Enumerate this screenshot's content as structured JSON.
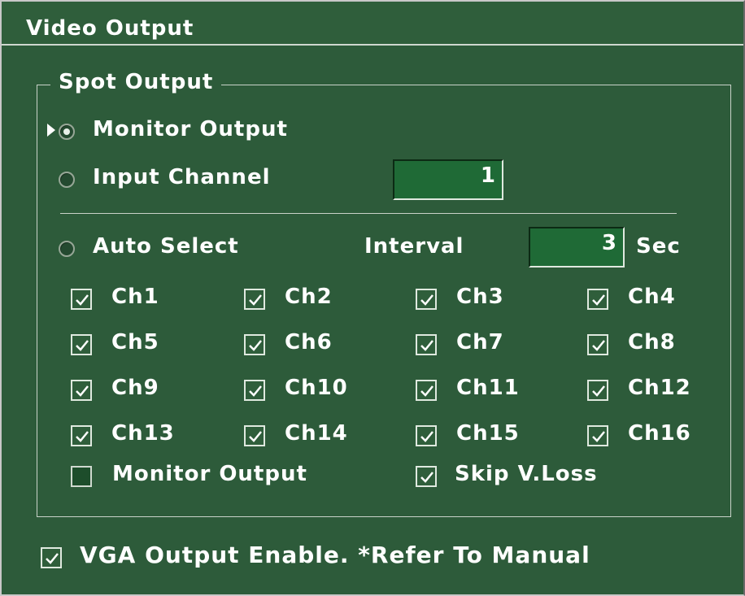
{
  "window": {
    "title": "Video Output"
  },
  "spot_output": {
    "legend": "Spot Output",
    "monitor_output_label": "Monitor Output",
    "input_channel_label": "Input Channel",
    "input_channel_value": "1",
    "auto_select_label": "Auto Select",
    "interval_label": "Interval",
    "interval_value": "3",
    "interval_unit": "Sec",
    "channels": [
      {
        "label": "Ch1",
        "checked": true
      },
      {
        "label": "Ch2",
        "checked": true
      },
      {
        "label": "Ch3",
        "checked": true
      },
      {
        "label": "Ch4",
        "checked": true
      },
      {
        "label": "Ch5",
        "checked": true
      },
      {
        "label": "Ch6",
        "checked": true
      },
      {
        "label": "Ch7",
        "checked": true
      },
      {
        "label": "Ch8",
        "checked": true
      },
      {
        "label": "Ch9",
        "checked": true
      },
      {
        "label": "Ch10",
        "checked": true
      },
      {
        "label": "Ch11",
        "checked": true
      },
      {
        "label": "Ch12",
        "checked": true
      },
      {
        "label": "Ch13",
        "checked": true
      },
      {
        "label": "Ch14",
        "checked": true
      },
      {
        "label": "Ch15",
        "checked": true
      },
      {
        "label": "Ch16",
        "checked": true
      }
    ],
    "monitor_output_check": {
      "label": "Monitor Output",
      "checked": false
    },
    "skip_vloss": {
      "label": "Skip V.Loss",
      "checked": true
    }
  },
  "vga": {
    "label": "VGA Output Enable. *Refer To Manual",
    "checked": true
  },
  "colors": {
    "background": "#2d5b3a",
    "field": "#1f6a36",
    "text": "#ffffff"
  }
}
